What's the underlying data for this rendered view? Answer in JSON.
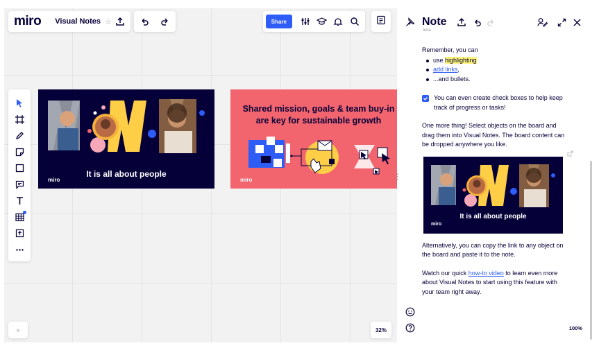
{
  "app": {
    "logo": "miro",
    "board_name": "Visual Notes",
    "share_label": "Share",
    "zoom": "32%",
    "expand_label": "»"
  },
  "frames": {
    "people": {
      "caption": "It is all about people",
      "logo": "miro"
    },
    "mission": {
      "title": "Shared mission, goals & team buy-in are key for sustainable growth",
      "logo": "miro"
    }
  },
  "note": {
    "title": "Note",
    "beta": "beta",
    "intro": "Remember, you can",
    "bullet_1_prefix": "use ",
    "bullet_1_highlight": "highlighting",
    "bullet_2_link": "add links",
    "bullet_2_suffix": ",",
    "bullet_3": "...and bullets.",
    "checkbox_text": "You can even create check boxes to help keep track of progress or tasks!",
    "para_select": "One more thing! Select objects on the board and drag them into Visual Notes. The board content can be dropped anywhere you like.",
    "embed_caption": "It is all about people",
    "embed_logo": "miro",
    "para_copy": "Alternatively, you can copy the link to any object on the board and paste it to the note.",
    "watch_prefix": "Watch our quick ",
    "watch_link": "how-to video",
    "watch_suffix": " to learn even more about Visual Notes to start using this feature with your team right away.",
    "zoom": "100%"
  },
  "colors": {
    "accent": "#2d5cf6",
    "navy": "#050038",
    "coral": "#f2646e",
    "yellow": "#fecf46",
    "highlight": "#fff47a"
  }
}
